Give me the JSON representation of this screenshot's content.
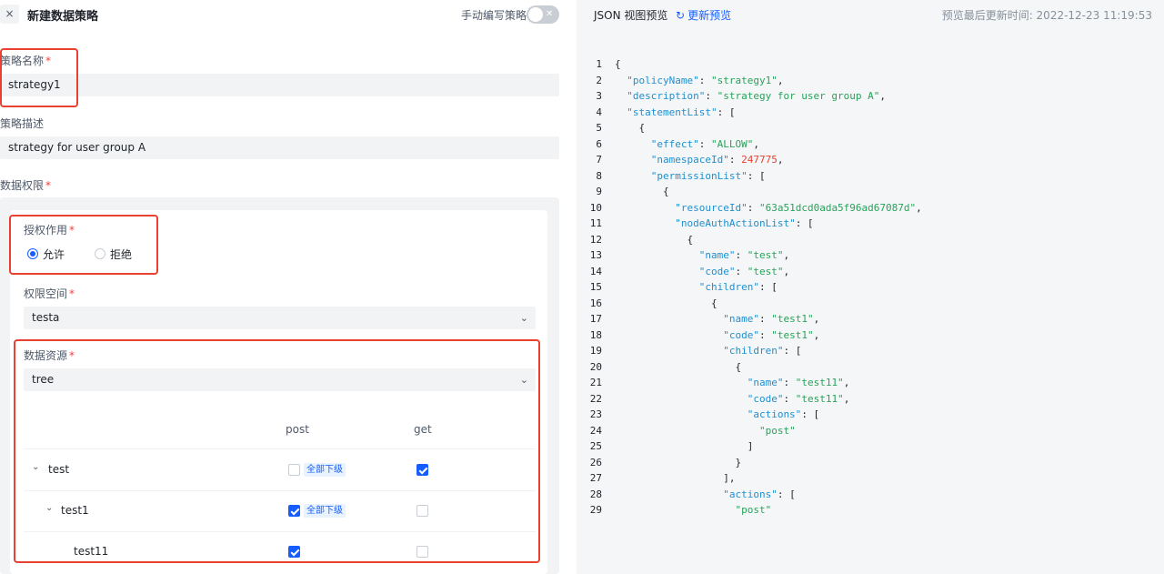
{
  "header": {
    "close_icon": "×",
    "title": "新建数据策略",
    "manual_label": "手动编写策略",
    "toggle_icon": "✕"
  },
  "form": {
    "policy_name_label": "策略名称",
    "policy_name_value": "strategy1",
    "description_label": "策略描述",
    "description_value": "strategy for user group A",
    "data_permission_label": "数据权限",
    "required_mark": "*",
    "effect_label": "授权作用",
    "effect_allow": "允许",
    "effect_deny": "拒绝",
    "namespace_label": "权限空间",
    "namespace_value": "testa",
    "resource_label": "数据资源",
    "resource_value": "tree",
    "chevron": "⌄"
  },
  "table": {
    "col_post": "post",
    "col_get": "get",
    "tag_label": "全部下级",
    "rows": [
      {
        "name": "test",
        "caret": "⌄",
        "post": false,
        "get": true
      },
      {
        "name": "test1",
        "caret": "⌄",
        "post": true,
        "get": false
      },
      {
        "name": "test11",
        "caret": "",
        "post": true,
        "get": false
      }
    ]
  },
  "preview": {
    "title": "JSON 视图预览",
    "refresh_icon": "↻",
    "refresh_label": "更新预览",
    "updated": "预览最后更新时间: 2022-12-23 11:19:53"
  },
  "colors": {
    "accent": "#165dff",
    "highlight": "#e8412f",
    "key": "#1f8fcf",
    "string": "#27a35a",
    "number": "#e8412f"
  },
  "code_lines": [
    [
      [
        "p",
        "{"
      ]
    ],
    [
      [
        "p",
        "  "
      ],
      [
        "k",
        "\"policyName\""
      ],
      [
        "p",
        ": "
      ],
      [
        "s",
        "\"strategy1\""
      ],
      [
        "p",
        ","
      ]
    ],
    [
      [
        "p",
        "  "
      ],
      [
        "k",
        "\"description\""
      ],
      [
        "p",
        ": "
      ],
      [
        "s",
        "\"strategy for user group A\""
      ],
      [
        "p",
        ","
      ]
    ],
    [
      [
        "p",
        "  "
      ],
      [
        "k",
        "\"statementList\""
      ],
      [
        "p",
        ": ["
      ]
    ],
    [
      [
        "p",
        "    {"
      ]
    ],
    [
      [
        "p",
        "      "
      ],
      [
        "k",
        "\"effect\""
      ],
      [
        "p",
        ": "
      ],
      [
        "s",
        "\"ALLOW\""
      ],
      [
        "p",
        ","
      ]
    ],
    [
      [
        "p",
        "      "
      ],
      [
        "k",
        "\"namespaceId\""
      ],
      [
        "p",
        ": "
      ],
      [
        "n",
        "247775"
      ],
      [
        "p",
        ","
      ]
    ],
    [
      [
        "p",
        "      "
      ],
      [
        "k",
        "\"permissionList\""
      ],
      [
        "p",
        ": ["
      ]
    ],
    [
      [
        "p",
        "        {"
      ]
    ],
    [
      [
        "p",
        "          "
      ],
      [
        "k",
        "\"resourceId\""
      ],
      [
        "p",
        ": "
      ],
      [
        "s",
        "\"63a51dcd0ada5f96ad67087d\""
      ],
      [
        "p",
        ","
      ]
    ],
    [
      [
        "p",
        "          "
      ],
      [
        "k",
        "\"nodeAuthActionList\""
      ],
      [
        "p",
        ": ["
      ]
    ],
    [
      [
        "p",
        "            {"
      ]
    ],
    [
      [
        "p",
        "              "
      ],
      [
        "k",
        "\"name\""
      ],
      [
        "p",
        ": "
      ],
      [
        "s",
        "\"test\""
      ],
      [
        "p",
        ","
      ]
    ],
    [
      [
        "p",
        "              "
      ],
      [
        "k",
        "\"code\""
      ],
      [
        "p",
        ": "
      ],
      [
        "s",
        "\"test\""
      ],
      [
        "p",
        ","
      ]
    ],
    [
      [
        "p",
        "              "
      ],
      [
        "k",
        "\"children\""
      ],
      [
        "p",
        ": ["
      ]
    ],
    [
      [
        "p",
        "                {"
      ]
    ],
    [
      [
        "p",
        "                  "
      ],
      [
        "k",
        "\"name\""
      ],
      [
        "p",
        ": "
      ],
      [
        "s",
        "\"test1\""
      ],
      [
        "p",
        ","
      ]
    ],
    [
      [
        "p",
        "                  "
      ],
      [
        "k",
        "\"code\""
      ],
      [
        "p",
        ": "
      ],
      [
        "s",
        "\"test1\""
      ],
      [
        "p",
        ","
      ]
    ],
    [
      [
        "p",
        "                  "
      ],
      [
        "k",
        "\"children\""
      ],
      [
        "p",
        ": ["
      ]
    ],
    [
      [
        "p",
        "                    {"
      ]
    ],
    [
      [
        "p",
        "                      "
      ],
      [
        "k",
        "\"name\""
      ],
      [
        "p",
        ": "
      ],
      [
        "s",
        "\"test11\""
      ],
      [
        "p",
        ","
      ]
    ],
    [
      [
        "p",
        "                      "
      ],
      [
        "k",
        "\"code\""
      ],
      [
        "p",
        ": "
      ],
      [
        "s",
        "\"test11\""
      ],
      [
        "p",
        ","
      ]
    ],
    [
      [
        "p",
        "                      "
      ],
      [
        "k",
        "\"actions\""
      ],
      [
        "p",
        ": ["
      ]
    ],
    [
      [
        "p",
        "                        "
      ],
      [
        "s",
        "\"post\""
      ]
    ],
    [
      [
        "p",
        "                      ]"
      ]
    ],
    [
      [
        "p",
        "                    }"
      ]
    ],
    [
      [
        "p",
        "                  ],"
      ]
    ],
    [
      [
        "p",
        "                  "
      ],
      [
        "k",
        "\"actions\""
      ],
      [
        "p",
        ": ["
      ]
    ],
    [
      [
        "p",
        "                    "
      ],
      [
        "s",
        "\"post\""
      ]
    ]
  ]
}
